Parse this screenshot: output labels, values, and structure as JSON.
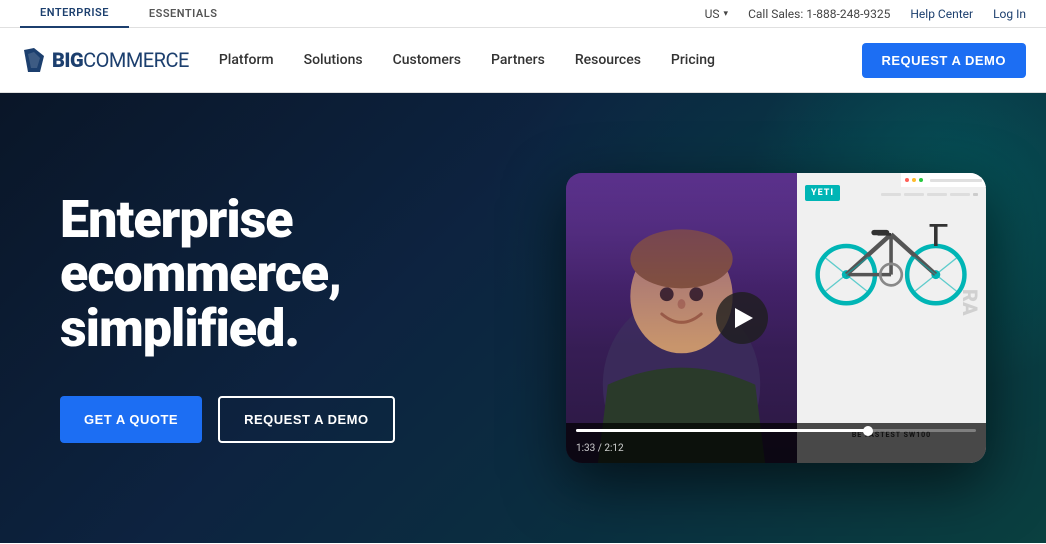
{
  "topbar": {
    "tabs": [
      {
        "id": "enterprise",
        "label": "ENTERPRISE",
        "active": true
      },
      {
        "id": "essentials",
        "label": "ESSENTIALS",
        "active": false
      }
    ],
    "locale": "US",
    "phone": "Call Sales: 1-888-248-9325",
    "help": "Help Center",
    "login": "Log In"
  },
  "nav": {
    "logo_big": "BIG",
    "logo_commerce": "COMMERCE",
    "links": [
      {
        "id": "platform",
        "label": "Platform"
      },
      {
        "id": "solutions",
        "label": "Solutions"
      },
      {
        "id": "customers",
        "label": "Customers"
      },
      {
        "id": "partners",
        "label": "Partners"
      },
      {
        "id": "resources",
        "label": "Resources"
      },
      {
        "id": "pricing",
        "label": "Pricing"
      }
    ],
    "cta": "REQUEST A DEMO"
  },
  "hero": {
    "title_line1": "Enterprise",
    "title_line2": "ecommerce,",
    "title_line3": "simplified.",
    "btn_quote": "GET A QUOTE",
    "btn_demo": "REQUEST A DEMO"
  },
  "video": {
    "yeti_badge": "YETI",
    "be_fastest": "BE FASTEST SW100",
    "rapid": "RA",
    "time_current": "1:33",
    "time_total": "2:12",
    "time_display": "1:33 / 2:12",
    "progress_percent": 73
  }
}
